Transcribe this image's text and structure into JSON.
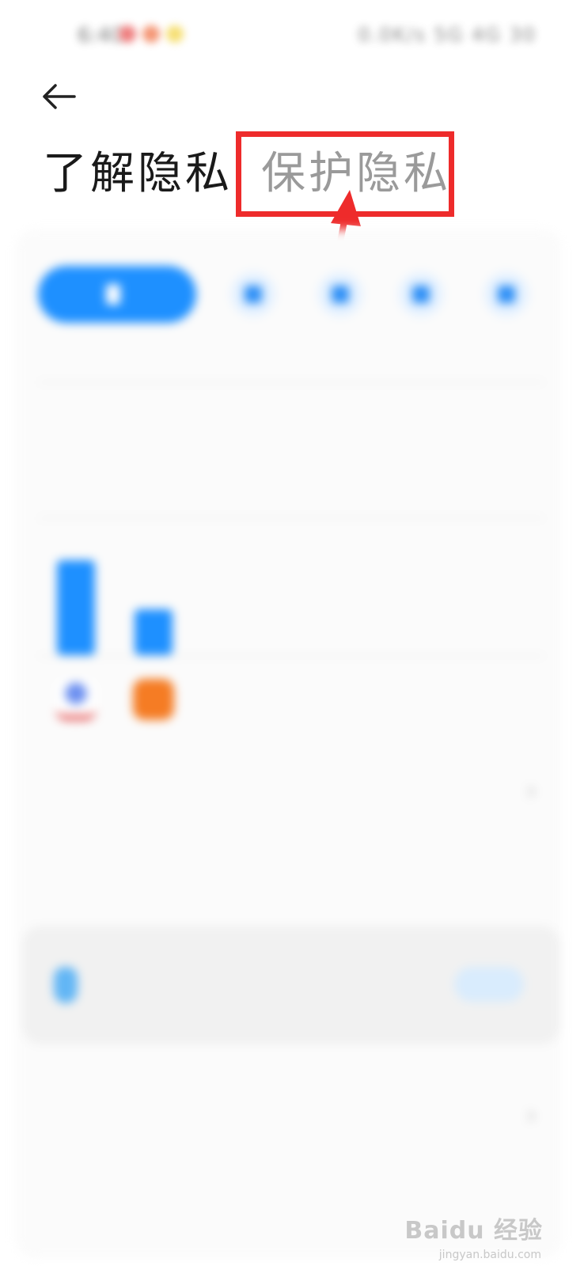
{
  "status_bar": {
    "time": "6:40",
    "right_text": "0.0K/s 5G 4G 30",
    "dot_colors": [
      "#e84a4a",
      "#f06a3a",
      "#f2d23a"
    ]
  },
  "header": {
    "back_icon": "arrow-left-icon",
    "tabs": [
      {
        "label": "了解隐私",
        "active": true
      },
      {
        "label": "保护隐私",
        "active": false
      }
    ]
  },
  "annotation": {
    "box_color": "#ee2b2b",
    "arrow_color": "#ee2b2b"
  },
  "content": {
    "filter_pill_label": "",
    "filter_icons": [
      "person-icon",
      "location-icon",
      "camera-icon",
      "folder-icon"
    ],
    "grid_labels": [
      "",
      ""
    ],
    "bar_chart_values": [
      1.0,
      0.48
    ],
    "apps": [
      {
        "name": "",
        "color": "#3b7de0"
      },
      {
        "name": "",
        "color": "#f57c24"
      }
    ],
    "row_all_records": "",
    "guard_card": {
      "title": "",
      "subtitle": "",
      "button": ""
    },
    "row_privacy_policy": "",
    "row_xiaomi_measures": ""
  },
  "watermark": {
    "text": "Baidu 经验",
    "url": "jingyan.baidu.com"
  },
  "colors": {
    "accent": "#1e90ff",
    "text_active": "#1a1a1a",
    "text_inactive": "#9a9a9a"
  }
}
